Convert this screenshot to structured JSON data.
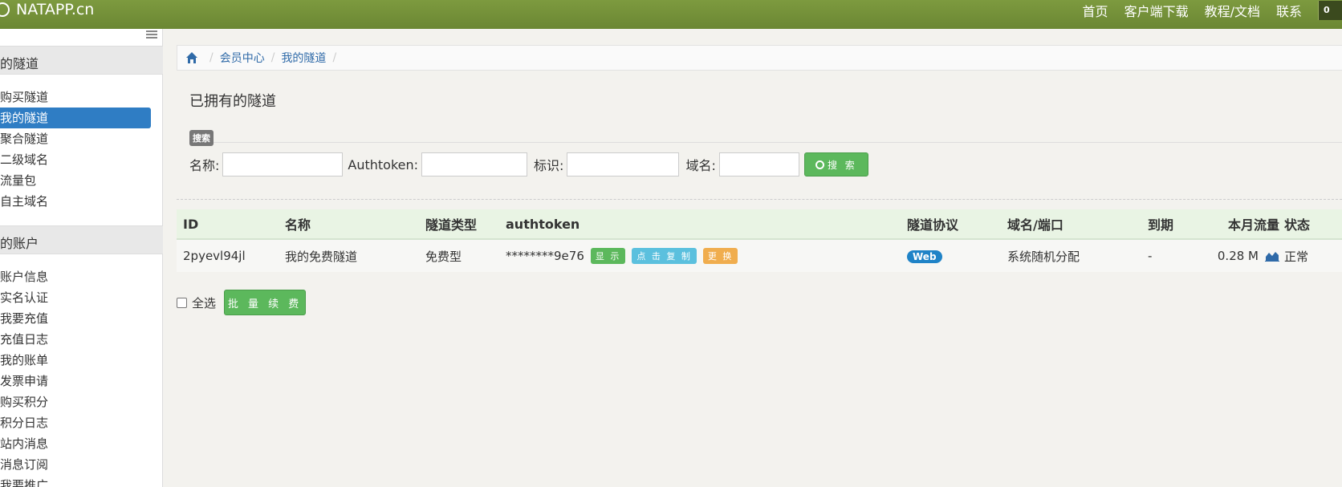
{
  "header": {
    "brand": "NATAPP.cn",
    "nav": [
      "首页",
      "客户端下载",
      "教程/文档",
      "联系"
    ],
    "badge": "0"
  },
  "sidebar": {
    "section1": "的隧道",
    "items1": [
      "购买隧道",
      "我的隧道",
      "聚合隧道",
      "二级域名",
      "流量包",
      "自主域名"
    ],
    "active_index": 1,
    "section2": "的账户",
    "items2": [
      "账户信息",
      "实名认证",
      "我要充值",
      "充值日志",
      "我的账单",
      "发票申请",
      "购买积分",
      "积分日志",
      "站内消息",
      "消息订阅",
      "我要推广"
    ]
  },
  "breadcrumb": {
    "items": [
      "会员中心",
      "我的隧道"
    ]
  },
  "page": {
    "title": "已拥有的隧道"
  },
  "search": {
    "tag": "搜索",
    "name_label": "名称:",
    "authtoken_label": "Authtoken:",
    "tag_label": "标识:",
    "domain_label": "域名:",
    "button": "搜 索",
    "name_value": "",
    "authtoken_value": "",
    "tag_value": "",
    "domain_value": ""
  },
  "table": {
    "headers": [
      "ID",
      "名称",
      "隧道类型",
      "authtoken",
      "隧道协议",
      "域名/端口",
      "到期",
      "本月流量",
      "状态"
    ],
    "rows": [
      {
        "id": "2pyevl94jl",
        "name": "我的免费隧道",
        "type": "免费型",
        "authtoken": "********9e76",
        "btn_show": "显 示",
        "btn_copy": "点 击 复 制",
        "btn_change": "更 换",
        "protocol": "Web",
        "domain": "系统随机分配",
        "expire": "-",
        "traffic": "0.28 M",
        "status": "正常"
      }
    ]
  },
  "footer": {
    "select_all": "全选",
    "renew": "批 量 续 费"
  },
  "colors": {
    "header": "#6b8733",
    "active": "#2f7dc4",
    "green": "#5cb85c",
    "info": "#5bc0de",
    "warning": "#f0ad4e"
  }
}
